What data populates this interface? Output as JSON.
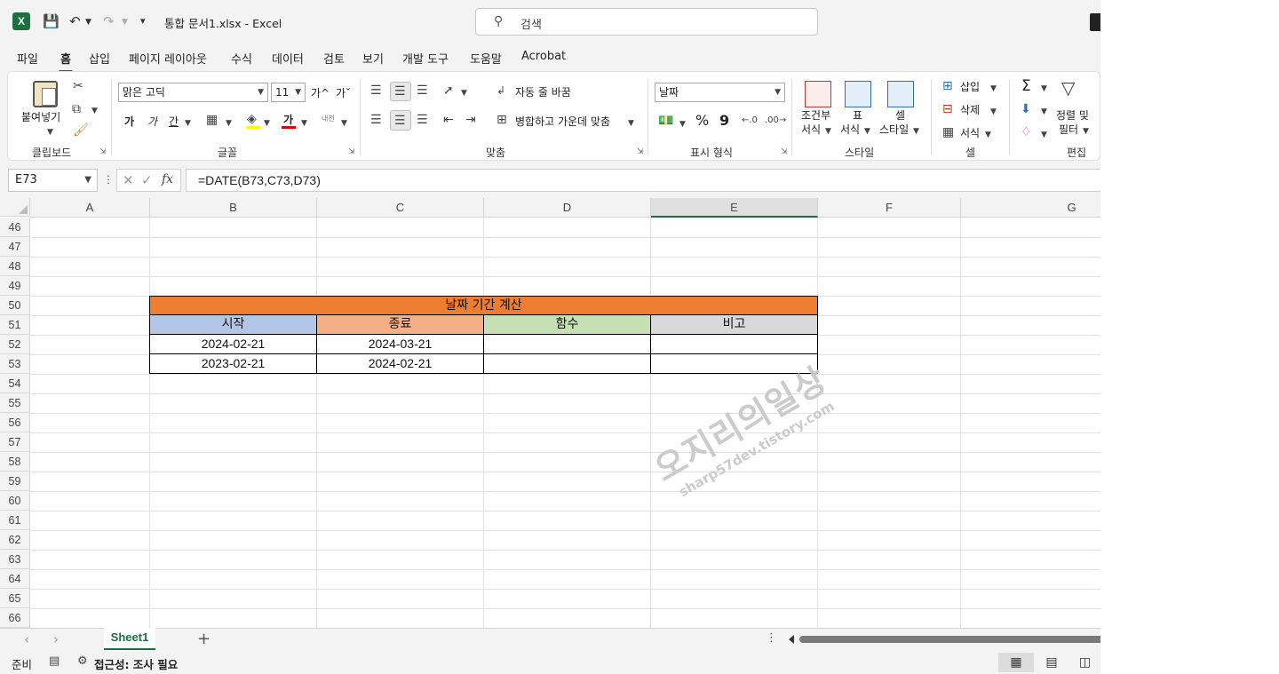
{
  "app": {
    "logo_letter": "X",
    "document_title": "통합 문서1.xlsx  -  Excel",
    "search_placeholder": "검색"
  },
  "ribbon_tabs": [
    "파일",
    "홈",
    "삽입",
    "페이지 레이아웃",
    "수식",
    "데이터",
    "검토",
    "보기",
    "개발 도구",
    "도움말",
    "Acrobat"
  ],
  "active_tab": "홈",
  "ribbon": {
    "clipboard": {
      "label": "클립보드",
      "paste": "붙여넣기"
    },
    "font": {
      "label": "글꼴",
      "font_name": "맑은 고딕",
      "font_size": "11",
      "bold": "가",
      "italic": "가",
      "underline": "간",
      "grow": "가^",
      "shrink": "가ˇ",
      "font_color_glyph": "가",
      "phonetic": "내천"
    },
    "alignment": {
      "label": "맞춤",
      "wrap_text": "자동 줄 바꿈",
      "merge_center": "병합하고 가운데 맞춤"
    },
    "number": {
      "label": "표시 형식",
      "format": "날짜",
      "percent": "%",
      "comma": "9"
    },
    "styles": {
      "label": "스타일",
      "conditional_1": "조건부",
      "conditional_2": "서식",
      "table_1": "표",
      "table_2": "서식",
      "cell_styles_1": "셀",
      "cell_styles_2": "스타일"
    },
    "cells": {
      "label": "셀",
      "insert": "삽입",
      "delete": "삭제",
      "format": "서식"
    },
    "editing": {
      "label": "편집",
      "sort_filter_1": "정렬 및",
      "sort_filter_2": "필터",
      "autosum": "Σ"
    }
  },
  "formula_bar": {
    "name_box": "E73",
    "fx": "fx",
    "formula": "=DATE(B73,C73,D73)"
  },
  "columns": [
    "A",
    "B",
    "C",
    "D",
    "E",
    "F",
    "G"
  ],
  "selected_column": "E",
  "rows": [
    "46",
    "47",
    "48",
    "49",
    "50",
    "51",
    "52",
    "53",
    "54",
    "55",
    "56",
    "57",
    "58",
    "59",
    "60",
    "61",
    "62",
    "63",
    "64",
    "65",
    "66"
  ],
  "table": {
    "title": "날짜 기간 계산",
    "title_color": "#ED7D31",
    "headers": [
      {
        "label": "시작",
        "color": "#B4C6E7"
      },
      {
        "label": "종료",
        "color": "#F4B084"
      },
      {
        "label": "함수",
        "color": "#C6E0B4"
      },
      {
        "label": "비고",
        "color": "#D9D9D9"
      }
    ],
    "rows": [
      [
        "2024-02-21",
        "2024-03-21",
        "",
        ""
      ],
      [
        "2023-02-21",
        "2024-02-21",
        "",
        ""
      ]
    ]
  },
  "watermark": {
    "main": "오지리의일상",
    "sub": "sharp57dev.tistory.com"
  },
  "sheet_tabs": [
    "Sheet1"
  ],
  "status": {
    "ready": "준비",
    "accessibility": "접근성: 조사 필요"
  },
  "colors": {
    "excel_green": "#1D6F42",
    "accent_orange": "#ED7D31"
  }
}
